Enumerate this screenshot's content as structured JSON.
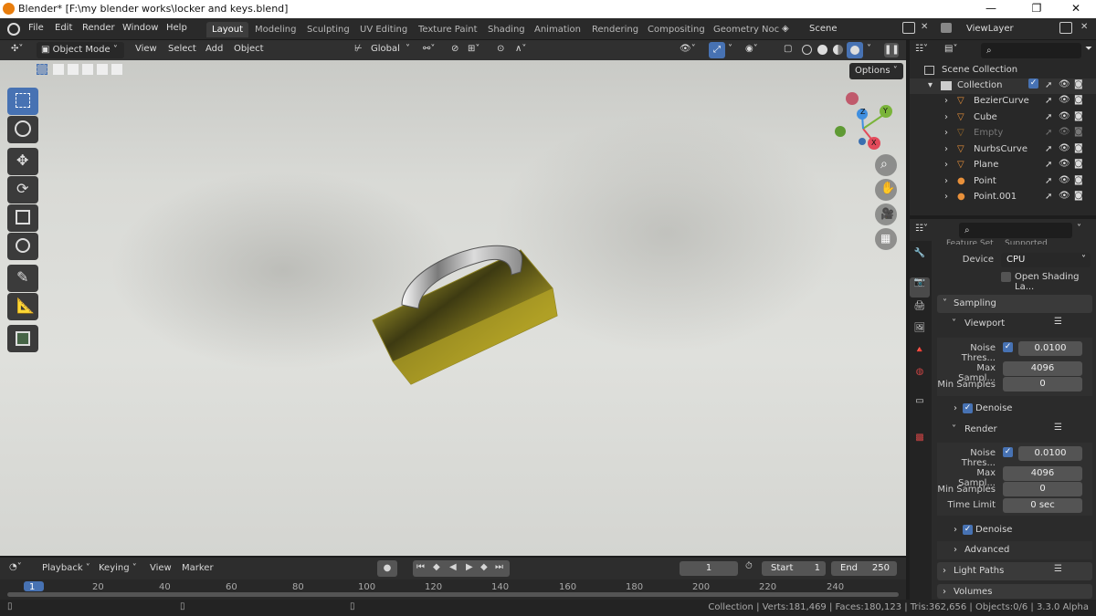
{
  "titlebar": {
    "title": "Blender* [F:\\my blender works\\locker and keys.blend]",
    "min": "—",
    "max": "❐",
    "close": "✕"
  },
  "menus": [
    "File",
    "Edit",
    "Render",
    "Window",
    "Help"
  ],
  "workspaces": [
    "Layout",
    "Modeling",
    "Sculpting",
    "UV Editing",
    "Texture Paint",
    "Shading",
    "Animation",
    "Rendering",
    "Compositing",
    "Geometry Noc"
  ],
  "scene": "Scene",
  "view_layer": "ViewLayer",
  "viewport_header": {
    "mode": "Object Mode",
    "view": "View",
    "select": "Select",
    "add": "Add",
    "object": "Object",
    "orientation": "Global",
    "options": "Options"
  },
  "gizmo": {
    "x": "X",
    "y": "Y",
    "z": "Z"
  },
  "outliner": {
    "scene_collection": "Scene Collection",
    "collection": "Collection",
    "items": [
      "BezierCurve",
      "Cube",
      "Empty",
      "NurbsCurve",
      "Plane",
      "Point",
      "Point.001"
    ]
  },
  "properties": {
    "feature_set_label": "Feature Set",
    "feature_set_value": "Supported",
    "device_label": "Device",
    "device_value": "CPU",
    "open_shading": "Open Shading La...",
    "sampling": "Sampling",
    "viewport": "Viewport",
    "noise_threshold_label": "Noise Thres...",
    "viewport_noise": "0.0100",
    "max_samples_label": "Max Sampl...",
    "viewport_max": "4096",
    "min_samples_label": "Min Samples",
    "viewport_min": "0",
    "denoise": "Denoise",
    "render": "Render",
    "render_noise": "0.0100",
    "render_max": "4096",
    "render_min": "0",
    "time_limit_label": "Time Limit",
    "time_limit": "0 sec",
    "render_denoise": "Denoise",
    "advanced": "Advanced",
    "light_paths": "Light Paths",
    "volumes": "Volumes"
  },
  "timeline": {
    "playback": "Playback",
    "keying": "Keying",
    "view": "View",
    "marker": "Marker",
    "current_frame": "1",
    "start_label": "Start",
    "start": "1",
    "end_label": "End",
    "end": "250",
    "ticks": [
      "1",
      "20",
      "40",
      "60",
      "80",
      "100",
      "120",
      "140",
      "160",
      "180",
      "200",
      "220",
      "240"
    ]
  },
  "status": "Collection | Verts:181,469 | Faces:180,123 | Tris:362,656 | Objects:0/6 | 3.3.0 Alpha",
  "colors": {
    "accent": "#4772b3",
    "orange": "#e87d0d",
    "padlock_body": "#c9b52a"
  }
}
